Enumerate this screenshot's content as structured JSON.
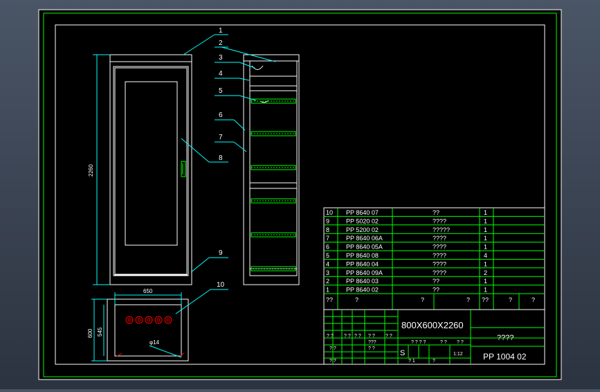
{
  "colors": {
    "background": "#000000",
    "frame": "#00ff00",
    "cyan": "#00ffff",
    "white": "#ffffff",
    "yellow": "#ffff00",
    "red": "#ff0000",
    "chrome": "#3a4454"
  },
  "dimensions": {
    "front_height": "2260",
    "plan_width": "650",
    "plan_depth_outer": "600",
    "plan_depth_inner": "545",
    "hole_dia": "φ14"
  },
  "callouts": [
    "1",
    "2",
    "3",
    "4",
    "5",
    "6",
    "7",
    "8",
    "9",
    "10"
  ],
  "bom": [
    {
      "no": "10",
      "code": "PP 8640 07",
      "name": "??",
      "qty": "1"
    },
    {
      "no": "9",
      "code": "PP 5020 02",
      "name": "????",
      "qty": "1"
    },
    {
      "no": "8",
      "code": "PP 5200 02",
      "name": "?????",
      "qty": "1"
    },
    {
      "no": "7",
      "code": "PP 8640 06A",
      "name": "????",
      "qty": "1"
    },
    {
      "no": "6",
      "code": "PP 8640 05A",
      "name": "????",
      "qty": "1"
    },
    {
      "no": "5",
      "code": "PP 8640 08",
      "name": "????",
      "qty": "4"
    },
    {
      "no": "4",
      "code": "PP 8640 04",
      "name": "????",
      "qty": "1"
    },
    {
      "no": "3",
      "code": "PP 8640 09A",
      "name": "????",
      "qty": "2"
    },
    {
      "no": "2",
      "code": "PP 8640 03",
      "name": "??",
      "qty": "1"
    },
    {
      "no": "1",
      "code": "PP 8640 02",
      "name": "??",
      "qty": "1"
    }
  ],
  "bom_header": [
    "??",
    "?",
    "?",
    "?",
    "??",
    "?",
    "?"
  ],
  "title_block": {
    "spec": "800X600X2260",
    "name": "????",
    "drawing_no": "PP 1004 02",
    "scale": "1:12",
    "stage": "S",
    "marks": [
      "? ?",
      "? ?",
      "? ?",
      "? ?",
      "? ?",
      "???",
      "? ? ? ?",
      "? ?",
      "? ?",
      "? ?",
      "? ?",
      "? 1",
      "?",
      "? ?"
    ]
  }
}
